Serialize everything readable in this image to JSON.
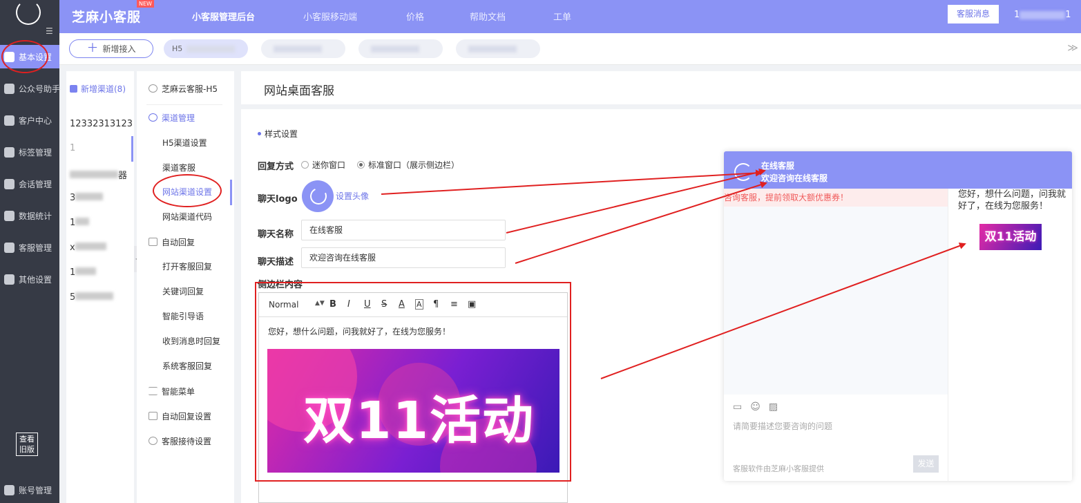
{
  "sidebar": {
    "items": [
      {
        "label": "基本设置"
      },
      {
        "label": "公众号助手"
      },
      {
        "label": "客户中心"
      },
      {
        "label": "标签管理"
      },
      {
        "label": "会话管理"
      },
      {
        "label": "数据统计"
      },
      {
        "label": "客服管理"
      },
      {
        "label": "其他设置"
      }
    ],
    "old_version": "查看旧版",
    "account": "账号管理"
  },
  "topbar": {
    "brand": "芝麻小客服",
    "new_tag": "NEW",
    "nav": [
      "小客服管理后台",
      "小客服移动端",
      "价格",
      "帮助文档",
      "工单"
    ],
    "message_button": "客服消息",
    "user_prefix": "1",
    "user_suffix": "1"
  },
  "tabbar": {
    "add_button": "新增接入",
    "chip_h5": "H5"
  },
  "channel_list": {
    "header": "新增渠道(8)",
    "first_item": "12332313123",
    "items_partial": [
      "1",
      "器",
      "3",
      "1",
      "x",
      "1",
      "5"
    ]
  },
  "submenu": {
    "site": "芝麻云客服-H5",
    "group_channel": "渠道管理",
    "items_channel": [
      "H5渠道设置",
      "渠道客服",
      "网站渠道设置",
      "网站渠道代码"
    ],
    "group_auto": "自动回复",
    "items_auto": [
      "打开客服回复",
      "关键词回复",
      "智能引导语",
      "收到消息时回复",
      "系统客服回复"
    ],
    "smart_menu": "智能菜单",
    "auto_reply_settings": "自动回复设置",
    "reception": "客服接待设置"
  },
  "main": {
    "title": "网站桌面客服",
    "style_section": "样式设置",
    "reply_mode_label": "回复方式",
    "reply_options": [
      "迷你窗口",
      "标准窗口（展示侧边栏）"
    ],
    "logo_label": "聊天logo",
    "set_avatar": "设置头像",
    "name_label": "聊天名称",
    "name_value": "在线客服",
    "desc_label": "聊天描述",
    "desc_value": "欢迎咨询在线客服",
    "sidebar_content_label": "侧边栏内容",
    "editor": {
      "format": "Normal",
      "toolbar": [
        "B",
        "I",
        "U",
        "S",
        "A",
        "A",
        "¶",
        "≡",
        "▣"
      ],
      "text": "您好，想什么问题，问我就好了，在线为您服务！",
      "banner_text": "双11活动"
    }
  },
  "preview": {
    "name": "在线客服",
    "desc": "欢迎咨询在线客服",
    "notice": "咨询客服，提前领取大额优惠券！",
    "input_placeholder": "请简要描述您要咨询的问题",
    "footer": "客服软件由芝麻小客服提供",
    "send": "发送",
    "side_text": "您好，想什么问题，问我就好了，在线为您服务！",
    "side_banner": "双11活动"
  },
  "colors": {
    "accent": "#8b93f5",
    "sidebar_bg": "#363a45",
    "annotation": "#e02020"
  }
}
